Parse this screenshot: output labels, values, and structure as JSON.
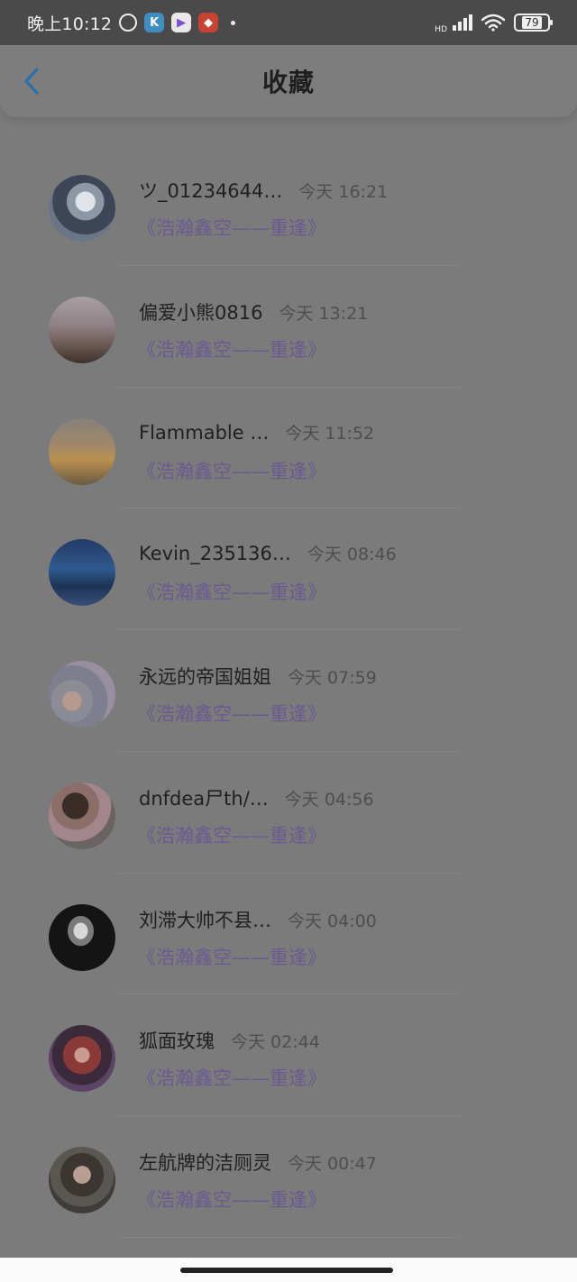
{
  "status_bar": {
    "time": "晚上10:12",
    "app_icons": [
      "alarm-icon",
      "k-app-icon",
      "video-play-icon",
      "red-app-icon"
    ],
    "network_label": "HD",
    "battery": "79"
  },
  "header": {
    "title": "收藏",
    "back_icon": "chevron-left-icon"
  },
  "colors": {
    "subtitle": "#6a5a90",
    "accent_back": "#2b6fa8"
  },
  "items": [
    {
      "name": "ツ_01234644…",
      "time": "今天 16:21",
      "subtitle": "《浩瀚鑫空——重逢》"
    },
    {
      "name": "偏爱小熊0816",
      "time": "今天 13:21",
      "subtitle": "《浩瀚鑫空——重逢》"
    },
    {
      "name": "Flammable …",
      "time": "今天 11:52",
      "subtitle": "《浩瀚鑫空——重逢》"
    },
    {
      "name": "Kevin_235136…",
      "time": "今天 08:46",
      "subtitle": "《浩瀚鑫空——重逢》"
    },
    {
      "name": "永远的帝国姐姐",
      "time": "今天 07:59",
      "subtitle": "《浩瀚鑫空——重逢》"
    },
    {
      "name": "dnfdea尸th/…",
      "time": "今天 04:56",
      "subtitle": "《浩瀚鑫空——重逢》"
    },
    {
      "name": "刘滞大帅不县…",
      "time": "今天 04:00",
      "subtitle": "《浩瀚鑫空——重逢》"
    },
    {
      "name": "狐面玫瑰",
      "time": "今天 02:44",
      "subtitle": "《浩瀚鑫空——重逢》"
    },
    {
      "name": "左航牌的洁厕灵",
      "time": "今天 00:47",
      "subtitle": "《浩瀚鑫空——重逢》"
    }
  ]
}
